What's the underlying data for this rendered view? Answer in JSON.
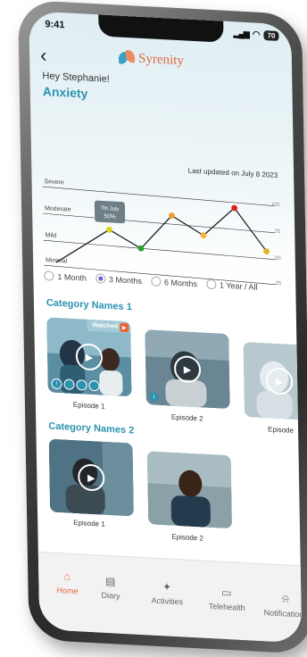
{
  "status": {
    "time": "9:41",
    "battery": "70"
  },
  "app": {
    "brand": "Syrenity"
  },
  "header": {
    "greeting": "Hey Stephanie!",
    "condition": "Anxiety"
  },
  "chart_data": {
    "type": "line",
    "title": "",
    "updated": "Last updated on July 8 2023",
    "levels": [
      "Severe",
      "Moderate",
      "Mild",
      "Minimal"
    ],
    "ticks": [
      "100",
      "75",
      "50",
      "25"
    ],
    "ylim": [
      25,
      100
    ],
    "x": [
      1,
      2,
      3,
      4,
      5,
      6,
      7
    ],
    "values": [
      60,
      45,
      78,
      62,
      90,
      52,
      0
    ],
    "points": [
      {
        "y": 60,
        "color": "#d8d81a"
      },
      {
        "y": 45,
        "color": "#29a329"
      },
      {
        "y": 78,
        "color": "#f29c2e"
      },
      {
        "y": 62,
        "color": "#f2b23e"
      },
      {
        "y": 90,
        "color": "#e21b1b"
      },
      {
        "y": 52,
        "color": "#e6b422"
      }
    ],
    "tooltip": {
      "date": "7th July",
      "value": "50%"
    }
  },
  "ranges": {
    "options": [
      "1 Month",
      "3 Months",
      "6 Months",
      "1 Year / All"
    ],
    "selected": "3 Months"
  },
  "categories": [
    {
      "name": "Category Names 1",
      "episodes": [
        {
          "label": "Episode 1",
          "watched": "Watched"
        },
        {
          "label": "Episode 2"
        },
        {
          "label": "Episode"
        }
      ]
    },
    {
      "name": "Category Names 2",
      "episodes": [
        {
          "label": "Episode 1"
        },
        {
          "label": "Episode 2"
        }
      ]
    }
  ],
  "tabs": [
    {
      "label": "Home",
      "icon": "home-icon"
    },
    {
      "label": "Diary",
      "icon": "book-icon"
    },
    {
      "label": "Activities",
      "icon": "figure-icon"
    },
    {
      "label": "Telehealth",
      "icon": "chat-icon"
    },
    {
      "label": "Notifications",
      "icon": "bell-icon"
    }
  ],
  "colors": {
    "accent": "#2b93b0",
    "active_tab": "#e8653a"
  }
}
